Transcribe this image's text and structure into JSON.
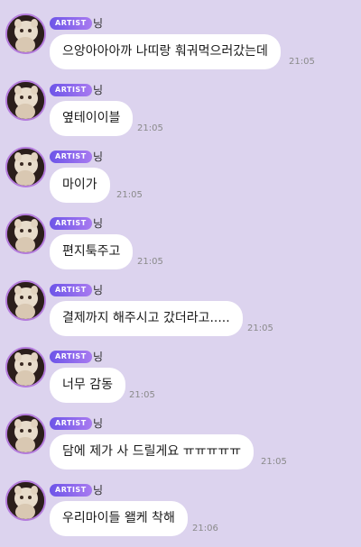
{
  "artist_badge": "ARTIST",
  "messages": [
    {
      "name": "닝",
      "text": "으앙아아아까 나띠랑 훠궈먹으러갔는데",
      "time": "21:05"
    },
    {
      "name": "닝",
      "text": "옆테이이블",
      "time": "21:05"
    },
    {
      "name": "닝",
      "text": "마이가",
      "time": "21:05"
    },
    {
      "name": "닝",
      "text": "편지툭주고",
      "time": "21:05"
    },
    {
      "name": "닝",
      "text": "결제까지 해주시고 갔더라고.....",
      "time": "21:05"
    },
    {
      "name": "닝",
      "text": "너무 감동",
      "time": "21:05"
    },
    {
      "name": "닝",
      "text": "담에 제가 사 드릴게요 ㅠㅠㅠㅠㅠ",
      "time": "21:05"
    },
    {
      "name": "닝",
      "text": "우리마이들 왤케 착해",
      "time": "21:06"
    }
  ],
  "colors": {
    "background": "#dcd3ee",
    "badge_start": "#6d55e8",
    "badge_end": "#a87af0",
    "avatar_ring": "#b47bdc",
    "bubble": "#ffffff"
  }
}
